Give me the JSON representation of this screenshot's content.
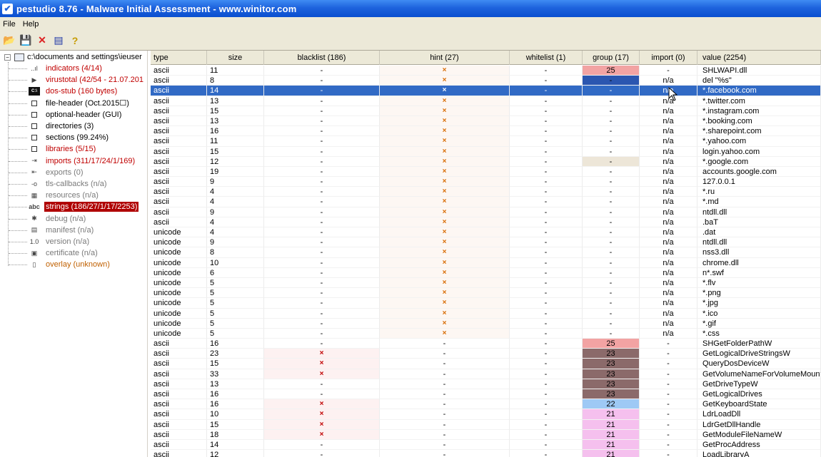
{
  "window": {
    "title": "pestudio 8.76 - Malware Initial Assessment - www.winitor.com",
    "app_icon": "check-icon"
  },
  "menu": [
    {
      "label": "File"
    },
    {
      "label": "Help"
    }
  ],
  "toolbar": {
    "buttons": [
      {
        "name": "open-folder-icon",
        "glyph": "📂"
      },
      {
        "name": "save-icon",
        "glyph": "💾"
      },
      {
        "name": "close-icon",
        "glyph": "✕"
      },
      {
        "name": "list-icon",
        "glyph": "▤"
      },
      {
        "name": "help-icon",
        "glyph": "?"
      }
    ]
  },
  "tree": {
    "root": {
      "label": "c:\\documents and settings\\ieuser"
    },
    "items": [
      {
        "label": "indicators (4/14)",
        "color": "#c00000",
        "icon": "bar-chart-icon",
        "glyph": "..ıl"
      },
      {
        "label": "virustotal (42/54 - 21.07.201",
        "color": "#c00000",
        "icon": "virustotal-icon",
        "glyph": "▶"
      },
      {
        "label": "dos-stub (160 bytes)",
        "color": "#c00000",
        "icon": "dos-icon",
        "glyph": "C:\\"
      },
      {
        "label": "file-header (Oct.2015☐)",
        "color": "#000000",
        "icon": "box-icon",
        "glyph": ""
      },
      {
        "label": "optional-header (GUI)",
        "color": "#000000",
        "icon": "box-icon",
        "glyph": ""
      },
      {
        "label": "directories (3)",
        "color": "#000000",
        "icon": "box-icon",
        "glyph": ""
      },
      {
        "label": "sections (99.24%)",
        "color": "#000000",
        "icon": "box-icon",
        "glyph": ""
      },
      {
        "label": "libraries (5/15)",
        "color": "#c00000",
        "icon": "box-icon",
        "glyph": ""
      },
      {
        "label": "imports (311/17/24/1/169)",
        "color": "#c00000",
        "icon": "import-icon",
        "glyph": "⇥"
      },
      {
        "label": "exports (0)",
        "color": "#7a7a7a",
        "icon": "export-icon",
        "glyph": "⇤"
      },
      {
        "label": "tls-callbacks (n/a)",
        "color": "#7a7a7a",
        "icon": "link-icon",
        "glyph": "-o"
      },
      {
        "label": "resources (n/a)",
        "color": "#7a7a7a",
        "icon": "resources-icon",
        "glyph": "▦"
      },
      {
        "label": "strings (186/27/1/17/2253)",
        "color": "#c00000",
        "icon": "abc-icon",
        "glyph": "abc",
        "selected": true
      },
      {
        "label": "debug (n/a)",
        "color": "#7a7a7a",
        "icon": "bug-icon",
        "glyph": "✱"
      },
      {
        "label": "manifest (n/a)",
        "color": "#7a7a7a",
        "icon": "manifest-icon",
        "glyph": "▤"
      },
      {
        "label": "version (n/a)",
        "color": "#7a7a7a",
        "icon": "version-icon",
        "glyph": "1.0"
      },
      {
        "label": "certificate (n/a)",
        "color": "#7a7a7a",
        "icon": "certificate-icon",
        "glyph": "▣"
      },
      {
        "label": "overlay (unknown)",
        "color": "#c06000",
        "icon": "page-icon",
        "glyph": "▯"
      }
    ]
  },
  "grid": {
    "columns": [
      "type",
      "size",
      "blacklist (186)",
      "hint (27)",
      "whitelist (1)",
      "group (17)",
      "import (0)",
      "value (2254)"
    ],
    "rows": [
      {
        "type": "ascii",
        "size": "11",
        "blacklist": "-",
        "hint": "×",
        "whitelist": "-",
        "group": "25",
        "group_bg": "#f2a3a3",
        "import": "-",
        "value": "SHLWAPI.dll"
      },
      {
        "type": "ascii",
        "size": "8",
        "blacklist": "-",
        "hint": "×",
        "whitelist": "-",
        "group": "-",
        "group_bg": "#2b56b0",
        "import": "n/a",
        "value": "del \"%s\""
      },
      {
        "type": "ascii",
        "size": "14",
        "blacklist": "-",
        "hint": "×",
        "whitelist": "-",
        "group": "-",
        "group_bg": "",
        "import": "n/a",
        "value": "*.facebook.com",
        "selected": true
      },
      {
        "type": "ascii",
        "size": "13",
        "blacklist": "-",
        "hint": "×",
        "whitelist": "-",
        "group": "-",
        "group_bg": "",
        "import": "n/a",
        "value": "*.twitter.com"
      },
      {
        "type": "ascii",
        "size": "15",
        "blacklist": "-",
        "hint": "×",
        "whitelist": "-",
        "group": "-",
        "group_bg": "",
        "import": "n/a",
        "value": "*.instagram.com"
      },
      {
        "type": "ascii",
        "size": "13",
        "blacklist": "-",
        "hint": "×",
        "whitelist": "-",
        "group": "-",
        "group_bg": "",
        "import": "n/a",
        "value": "*.booking.com"
      },
      {
        "type": "ascii",
        "size": "16",
        "blacklist": "-",
        "hint": "×",
        "whitelist": "-",
        "group": "-",
        "group_bg": "",
        "import": "n/a",
        "value": "*.sharepoint.com"
      },
      {
        "type": "ascii",
        "size": "11",
        "blacklist": "-",
        "hint": "×",
        "whitelist": "-",
        "group": "-",
        "group_bg": "",
        "import": "n/a",
        "value": "*.yahoo.com"
      },
      {
        "type": "ascii",
        "size": "15",
        "blacklist": "-",
        "hint": "×",
        "whitelist": "-",
        "group": "-",
        "group_bg": "",
        "import": "n/a",
        "value": "login.yahoo.com"
      },
      {
        "type": "ascii",
        "size": "12",
        "blacklist": "-",
        "hint": "×",
        "whitelist": "-",
        "group": "-",
        "group_bg": "#ede6d8",
        "import": "n/a",
        "value": "*.google.com"
      },
      {
        "type": "ascii",
        "size": "19",
        "blacklist": "-",
        "hint": "×",
        "whitelist": "-",
        "group": "-",
        "group_bg": "",
        "import": "n/a",
        "value": "accounts.google.com"
      },
      {
        "type": "ascii",
        "size": "9",
        "blacklist": "-",
        "hint": "×",
        "whitelist": "-",
        "group": "-",
        "group_bg": "",
        "import": "n/a",
        "value": "127.0.0.1"
      },
      {
        "type": "ascii",
        "size": "4",
        "blacklist": "-",
        "hint": "×",
        "whitelist": "-",
        "group": "-",
        "group_bg": "",
        "import": "n/a",
        "value": "*.ru"
      },
      {
        "type": "ascii",
        "size": "4",
        "blacklist": "-",
        "hint": "×",
        "whitelist": "-",
        "group": "-",
        "group_bg": "",
        "import": "n/a",
        "value": "*.md"
      },
      {
        "type": "ascii",
        "size": "9",
        "blacklist": "-",
        "hint": "×",
        "whitelist": "-",
        "group": "-",
        "group_bg": "",
        "import": "n/a",
        "value": "ntdll.dll"
      },
      {
        "type": "ascii",
        "size": "4",
        "blacklist": "-",
        "hint": "×",
        "whitelist": "-",
        "group": "-",
        "group_bg": "",
        "import": "n/a",
        "value": ".baT"
      },
      {
        "type": "unicode",
        "size": "4",
        "blacklist": "-",
        "hint": "×",
        "whitelist": "-",
        "group": "-",
        "group_bg": "",
        "import": "n/a",
        "value": ".dat"
      },
      {
        "type": "unicode",
        "size": "9",
        "blacklist": "-",
        "hint": "×",
        "whitelist": "-",
        "group": "-",
        "group_bg": "",
        "import": "n/a",
        "value": "ntdll.dll"
      },
      {
        "type": "unicode",
        "size": "8",
        "blacklist": "-",
        "hint": "×",
        "whitelist": "-",
        "group": "-",
        "group_bg": "",
        "import": "n/a",
        "value": "nss3.dll"
      },
      {
        "type": "unicode",
        "size": "10",
        "blacklist": "-",
        "hint": "×",
        "whitelist": "-",
        "group": "-",
        "group_bg": "",
        "import": "n/a",
        "value": "chrome.dll"
      },
      {
        "type": "unicode",
        "size": "6",
        "blacklist": "-",
        "hint": "×",
        "whitelist": "-",
        "group": "-",
        "group_bg": "",
        "import": "n/a",
        "value": "n*.swf"
      },
      {
        "type": "unicode",
        "size": "5",
        "blacklist": "-",
        "hint": "×",
        "whitelist": "-",
        "group": "-",
        "group_bg": "",
        "import": "n/a",
        "value": "*.flv"
      },
      {
        "type": "unicode",
        "size": "5",
        "blacklist": "-",
        "hint": "×",
        "whitelist": "-",
        "group": "-",
        "group_bg": "",
        "import": "n/a",
        "value": "*.png"
      },
      {
        "type": "unicode",
        "size": "5",
        "blacklist": "-",
        "hint": "×",
        "whitelist": "-",
        "group": "-",
        "group_bg": "",
        "import": "n/a",
        "value": "*.jpg"
      },
      {
        "type": "unicode",
        "size": "5",
        "blacklist": "-",
        "hint": "×",
        "whitelist": "-",
        "group": "-",
        "group_bg": "",
        "import": "n/a",
        "value": "*.ico"
      },
      {
        "type": "unicode",
        "size": "5",
        "blacklist": "-",
        "hint": "×",
        "whitelist": "-",
        "group": "-",
        "group_bg": "",
        "import": "n/a",
        "value": "*.gif"
      },
      {
        "type": "unicode",
        "size": "5",
        "blacklist": "-",
        "hint": "×",
        "whitelist": "-",
        "group": "-",
        "group_bg": "",
        "import": "n/a",
        "value": "*.css"
      },
      {
        "type": "ascii",
        "size": "16",
        "blacklist": "-",
        "hint": "-",
        "whitelist": "-",
        "group": "25",
        "group_bg": "#f2a3a3",
        "import": "-",
        "value": "SHGetFolderPathW"
      },
      {
        "type": "ascii",
        "size": "23",
        "blacklist": "×",
        "hint": "-",
        "whitelist": "-",
        "group": "23",
        "group_bg": "#8b6a6a",
        "import": "-",
        "value": "GetLogicalDriveStringsW"
      },
      {
        "type": "ascii",
        "size": "15",
        "blacklist": "×",
        "hint": "-",
        "whitelist": "-",
        "group": "23",
        "group_bg": "#8b6a6a",
        "import": "-",
        "value": "QueryDosDeviceW"
      },
      {
        "type": "ascii",
        "size": "33",
        "blacklist": "×",
        "hint": "-",
        "whitelist": "-",
        "group": "23",
        "group_bg": "#8b6a6a",
        "import": "-",
        "value": "GetVolumeNameForVolumeMountPointW"
      },
      {
        "type": "ascii",
        "size": "13",
        "blacklist": "-",
        "hint": "-",
        "whitelist": "-",
        "group": "23",
        "group_bg": "#8b6a6a",
        "import": "-",
        "value": "GetDriveTypeW"
      },
      {
        "type": "ascii",
        "size": "16",
        "blacklist": "-",
        "hint": "-",
        "whitelist": "-",
        "group": "23",
        "group_bg": "#8b6a6a",
        "import": "-",
        "value": "GetLogicalDrives"
      },
      {
        "type": "ascii",
        "size": "16",
        "blacklist": "×",
        "hint": "-",
        "whitelist": "-",
        "group": "22",
        "group_bg": "#9ec9f5",
        "import": "-",
        "value": "GetKeyboardState"
      },
      {
        "type": "ascii",
        "size": "10",
        "blacklist": "×",
        "hint": "-",
        "whitelist": "-",
        "group": "21",
        "group_bg": "#f5c0ee",
        "import": "-",
        "value": "LdrLoadDll"
      },
      {
        "type": "ascii",
        "size": "15",
        "blacklist": "×",
        "hint": "-",
        "whitelist": "-",
        "group": "21",
        "group_bg": "#f5c0ee",
        "import": "-",
        "value": "LdrGetDllHandle"
      },
      {
        "type": "ascii",
        "size": "18",
        "blacklist": "×",
        "hint": "-",
        "whitelist": "-",
        "group": "21",
        "group_bg": "#f5c0ee",
        "import": "-",
        "value": "GetModuleFileNameW"
      },
      {
        "type": "ascii",
        "size": "14",
        "blacklist": "-",
        "hint": "-",
        "whitelist": "-",
        "group": "21",
        "group_bg": "#f5c0ee",
        "import": "-",
        "value": "GetProcAddress"
      },
      {
        "type": "ascii",
        "size": "12",
        "blacklist": "-",
        "hint": "-",
        "whitelist": "-",
        "group": "21",
        "group_bg": "#f5c0ee",
        "import": "-",
        "value": "LoadLibraryA"
      }
    ]
  },
  "colors": {
    "titlebar": "#1e63dd",
    "selection": "#316ac5",
    "tree_selected": "#b00000",
    "hint_mark": "#d86a00",
    "blacklist_mark": "#c00000"
  }
}
